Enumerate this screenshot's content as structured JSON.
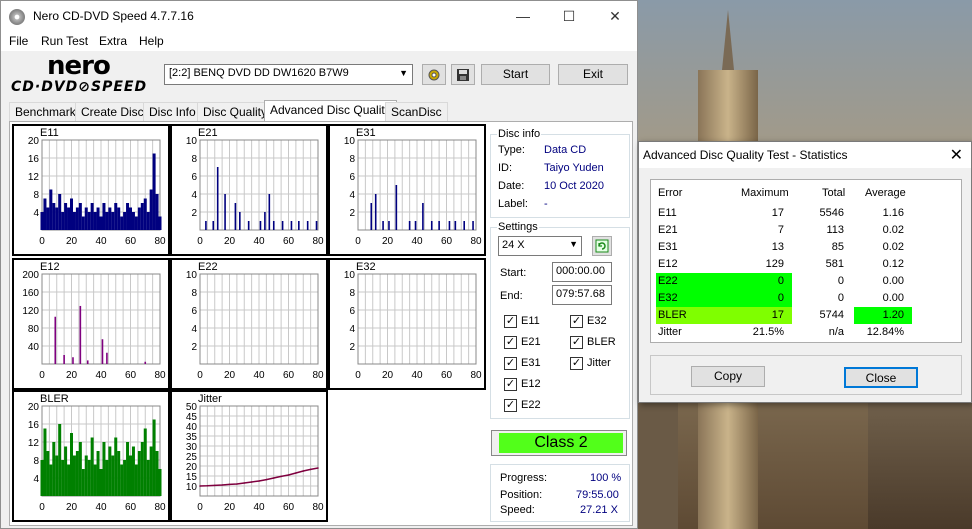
{
  "app": {
    "title": "Nero CD-DVD Speed 4.7.7.16",
    "window_controls": [
      "—",
      "☐",
      "✕"
    ],
    "menu": [
      "File",
      "Run Test",
      "Extra",
      "Help"
    ],
    "logo_top": "nero",
    "logo_bottom": "CD·DVD⊘SPEED"
  },
  "toolbar": {
    "drive": "[2:2]   BENQ DVD DD DW1620 B7W9",
    "start_label": "Start",
    "exit_label": "Exit"
  },
  "tabs": [
    "Benchmark",
    "Create Disc",
    "Disc Info",
    "Disc Quality",
    "Advanced Disc Quality",
    "ScanDisc"
  ],
  "active_tab": "Advanced Disc Quality",
  "disc_info": {
    "group_label": "Disc info",
    "type_label": "Type:",
    "type": "Data CD",
    "id_label": "ID:",
    "id": "Taiyo Yuden",
    "date_label": "Date:",
    "date": "10 Oct 2020",
    "label_label": "Label:",
    "label": "-"
  },
  "settings": {
    "group_label": "Settings",
    "speed": "24 X",
    "start_label": "Start:",
    "start": "000:00.00",
    "end_label": "End:",
    "end": "079:57.68",
    "checks_left": [
      "E11",
      "E21",
      "E31",
      "E12",
      "E22"
    ],
    "checks_right": [
      "E32",
      "BLER",
      "Jitter"
    ]
  },
  "class_label": "Class 2",
  "progress": {
    "progress_label": "Progress:",
    "progress": "100 %",
    "position_label": "Position:",
    "position": "79:55.00",
    "speed_label": "Speed:",
    "speed": "27.21 X"
  },
  "chart_data": [
    {
      "name": "E11",
      "type": "bar",
      "color": "#00007f",
      "yticks": [
        "20",
        "16",
        "12",
        "8",
        "4"
      ],
      "xticks": [
        "0",
        "20",
        "40",
        "60",
        "80"
      ],
      "ylim": [
        0,
        20
      ],
      "xlim": [
        0,
        80
      ],
      "x": [
        0,
        2,
        4,
        6,
        8,
        10,
        12,
        14,
        16,
        18,
        20,
        22,
        24,
        26,
        28,
        30,
        32,
        34,
        36,
        38,
        40,
        42,
        44,
        46,
        48,
        50,
        52,
        54,
        56,
        58,
        60,
        62,
        64,
        66,
        68,
        70,
        72,
        74,
        76,
        78,
        80
      ],
      "values": [
        4,
        7,
        5,
        9,
        6,
        5,
        8,
        4,
        6,
        5,
        7,
        4,
        5,
        6,
        3,
        5,
        4,
        6,
        4,
        5,
        3,
        6,
        4,
        5,
        4,
        6,
        5,
        3,
        4,
        6,
        5,
        4,
        3,
        5,
        6,
        7,
        4,
        9,
        17,
        8,
        3
      ]
    },
    {
      "name": "E21",
      "type": "bar",
      "color": "#00007f",
      "yticks": [
        "10",
        "8",
        "6",
        "4",
        "2"
      ],
      "xticks": [
        "0",
        "20",
        "40",
        "60",
        "80"
      ],
      "ylim": [
        0,
        10
      ],
      "xlim": [
        0,
        80
      ],
      "x": [
        4,
        9,
        12,
        17,
        24,
        27,
        33,
        41,
        44,
        47,
        50,
        56,
        62,
        67,
        73,
        79
      ],
      "values": [
        1,
        1,
        7,
        4,
        3,
        2,
        1,
        1,
        2,
        4,
        1,
        1,
        1,
        1,
        1,
        1
      ]
    },
    {
      "name": "E31",
      "type": "bar",
      "color": "#00007f",
      "yticks": [
        "10",
        "8",
        "6",
        "4",
        "2"
      ],
      "xticks": [
        "0",
        "20",
        "40",
        "60",
        "80"
      ],
      "ylim": [
        0,
        10
      ],
      "xlim": [
        0,
        80
      ],
      "x": [
        9,
        12,
        17,
        21,
        26,
        35,
        39,
        44,
        50,
        55,
        62,
        66,
        72,
        78
      ],
      "values": [
        3,
        4,
        1,
        1,
        5,
        1,
        1,
        3,
        1,
        1,
        1,
        1,
        1,
        1
      ]
    },
    {
      "name": "E12",
      "type": "bar",
      "color": "#7f007f",
      "yticks": [
        "200",
        "160",
        "120",
        "80",
        "40"
      ],
      "xticks": [
        "0",
        "20",
        "40",
        "60",
        "80"
      ],
      "ylim": [
        0,
        200
      ],
      "xlim": [
        0,
        80
      ],
      "x": [
        9,
        15,
        21,
        26,
        31,
        41,
        44,
        70
      ],
      "values": [
        105,
        20,
        15,
        129,
        8,
        55,
        25,
        5
      ]
    },
    {
      "name": "E22",
      "type": "bar",
      "color": "#00007f",
      "yticks": [
        "10",
        "8",
        "6",
        "4",
        "2"
      ],
      "xticks": [
        "0",
        "20",
        "40",
        "60",
        "80"
      ],
      "ylim": [
        0,
        10
      ],
      "xlim": [
        0,
        80
      ],
      "x": [],
      "values": []
    },
    {
      "name": "E32",
      "type": "bar",
      "color": "#00007f",
      "yticks": [
        "10",
        "8",
        "6",
        "4",
        "2"
      ],
      "xticks": [
        "0",
        "20",
        "40",
        "60",
        "80"
      ],
      "ylim": [
        0,
        10
      ],
      "xlim": [
        0,
        80
      ],
      "x": [],
      "values": []
    },
    {
      "name": "BLER",
      "type": "bar",
      "color": "#008000",
      "yticks": [
        "20",
        "16",
        "12",
        "8",
        "4"
      ],
      "xticks": [
        "0",
        "20",
        "40",
        "60",
        "80"
      ],
      "ylim": [
        0,
        20
      ],
      "xlim": [
        0,
        80
      ],
      "x": [
        0,
        2,
        4,
        6,
        8,
        10,
        12,
        14,
        16,
        18,
        20,
        22,
        24,
        26,
        28,
        30,
        32,
        34,
        36,
        38,
        40,
        42,
        44,
        46,
        48,
        50,
        52,
        54,
        56,
        58,
        60,
        62,
        64,
        66,
        68,
        70,
        72,
        74,
        76,
        78,
        80
      ],
      "values": [
        8,
        15,
        10,
        7,
        12,
        9,
        16,
        8,
        11,
        7,
        14,
        9,
        10,
        12,
        6,
        9,
        8,
        13,
        7,
        10,
        6,
        12,
        8,
        11,
        9,
        13,
        10,
        7,
        8,
        12,
        9,
        11,
        7,
        10,
        12,
        15,
        8,
        11,
        17,
        10,
        6
      ]
    },
    {
      "name": "Jitter",
      "type": "line",
      "color": "#7f003f",
      "yticks": [
        "50",
        "45",
        "40",
        "35",
        "30",
        "25",
        "20",
        "15",
        "10"
      ],
      "xticks": [
        "0",
        "20",
        "40",
        "60",
        "80"
      ],
      "ylim": [
        5,
        50
      ],
      "xlim": [
        0,
        80
      ],
      "x": [
        0,
        5,
        10,
        15,
        20,
        25,
        30,
        35,
        40,
        45,
        50,
        55,
        60,
        65,
        70,
        75,
        80
      ],
      "values": [
        10.0,
        10.1,
        10.3,
        10.5,
        10.8,
        11.0,
        11.5,
        12.0,
        12.5,
        13.2,
        14.0,
        14.8,
        15.5,
        16.5,
        17.5,
        18.3,
        19.0
      ]
    }
  ],
  "stats": {
    "title": "Advanced Disc Quality Test - Statistics",
    "headers": [
      "Error",
      "Maximum",
      "Total",
      "Average"
    ],
    "rows": [
      [
        "E11",
        "17",
        "5546",
        "1.16"
      ],
      [
        "E21",
        "7",
        "113",
        "0.02"
      ],
      [
        "E31",
        "13",
        "85",
        "0.02"
      ],
      [
        "E12",
        "129",
        "581",
        "0.12"
      ],
      [
        "E22",
        "0",
        "0",
        "0.00"
      ],
      [
        "E32",
        "0",
        "0",
        "0.00"
      ],
      [
        "BLER",
        "17",
        "5744",
        "1.20"
      ],
      [
        "Jitter",
        "21.5%",
        "n/a",
        "12.84%"
      ]
    ],
    "copy_label": "Copy",
    "close_label": "Close"
  },
  "colors": {
    "pass_green": "#00ff00",
    "bler_lime": "#7fff00",
    "class_green": "#52ff1a"
  }
}
